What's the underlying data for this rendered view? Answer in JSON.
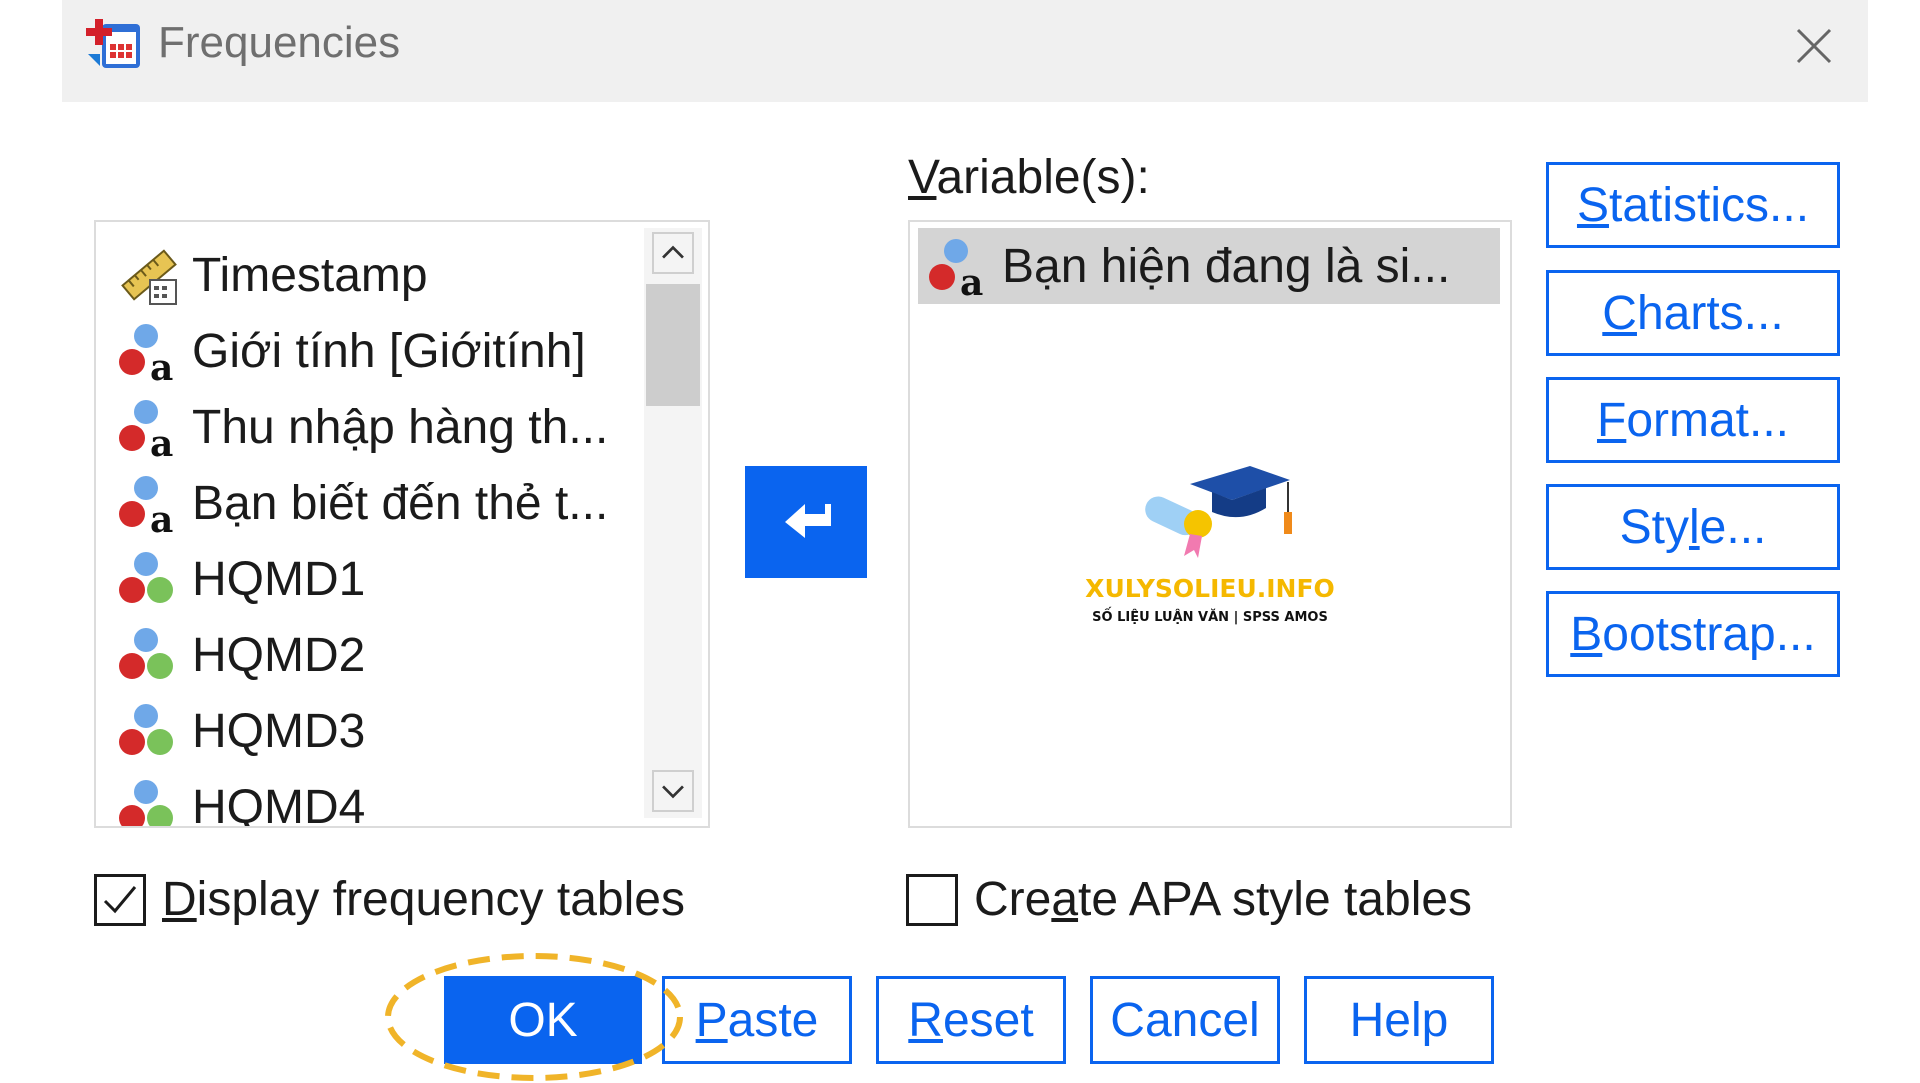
{
  "window": {
    "title": "Frequencies",
    "close_icon": "close-icon",
    "app_icon": "frequencies-icon"
  },
  "source_list": {
    "items": [
      {
        "label": "Timestamp",
        "icon": "ruler-variable-icon"
      },
      {
        "label": "Giới tính [Giớitính]",
        "icon": "nominal-string-variable-icon"
      },
      {
        "label": "Thu nhập hàng th...",
        "icon": "nominal-string-variable-icon"
      },
      {
        "label": "Bạn biết đến thẻ t...",
        "icon": "nominal-string-variable-icon"
      },
      {
        "label": "HQMD1",
        "icon": "nominal-variable-icon"
      },
      {
        "label": "HQMD2",
        "icon": "nominal-variable-icon"
      },
      {
        "label": "HQMD3",
        "icon": "nominal-variable-icon"
      },
      {
        "label": "HQMD4",
        "icon": "nominal-variable-icon"
      }
    ]
  },
  "move_button": {
    "icon": "move-arrow-icon"
  },
  "target": {
    "label_prefix": "V",
    "label_rest": "ariable(s):",
    "items": [
      {
        "label": "Bạn hiện đang là si...",
        "icon": "nominal-string-variable-icon"
      }
    ]
  },
  "watermark": {
    "title": "XULYSOLIEU.INFO",
    "subtitle": "SỐ LIỆU LUẬN VĂN | SPSS AMOS"
  },
  "side_buttons": [
    {
      "u": "S",
      "rest": "tatistics...",
      "pre": ""
    },
    {
      "u": "C",
      "rest": "harts...",
      "pre": ""
    },
    {
      "u": "F",
      "rest": "ormat...",
      "pre": ""
    },
    {
      "u": "l",
      "rest": "e...",
      "pre": "Sty"
    },
    {
      "u": "B",
      "rest": "ootstrap...",
      "pre": ""
    }
  ],
  "checkboxes": {
    "display_freq": {
      "checked": true,
      "u": "D",
      "rest": "isplay frequency tables"
    },
    "apa": {
      "checked": false,
      "pre": "Cre",
      "u": "a",
      "rest": "te APA style tables"
    }
  },
  "bottom_buttons": {
    "ok": "OK",
    "paste": {
      "u": "P",
      "rest": "aste"
    },
    "reset": {
      "u": "R",
      "rest": "eset"
    },
    "cancel": "Cancel",
    "help": "Help"
  },
  "colors": {
    "accent": "#0a64ef",
    "highlight": "#f0b429"
  }
}
